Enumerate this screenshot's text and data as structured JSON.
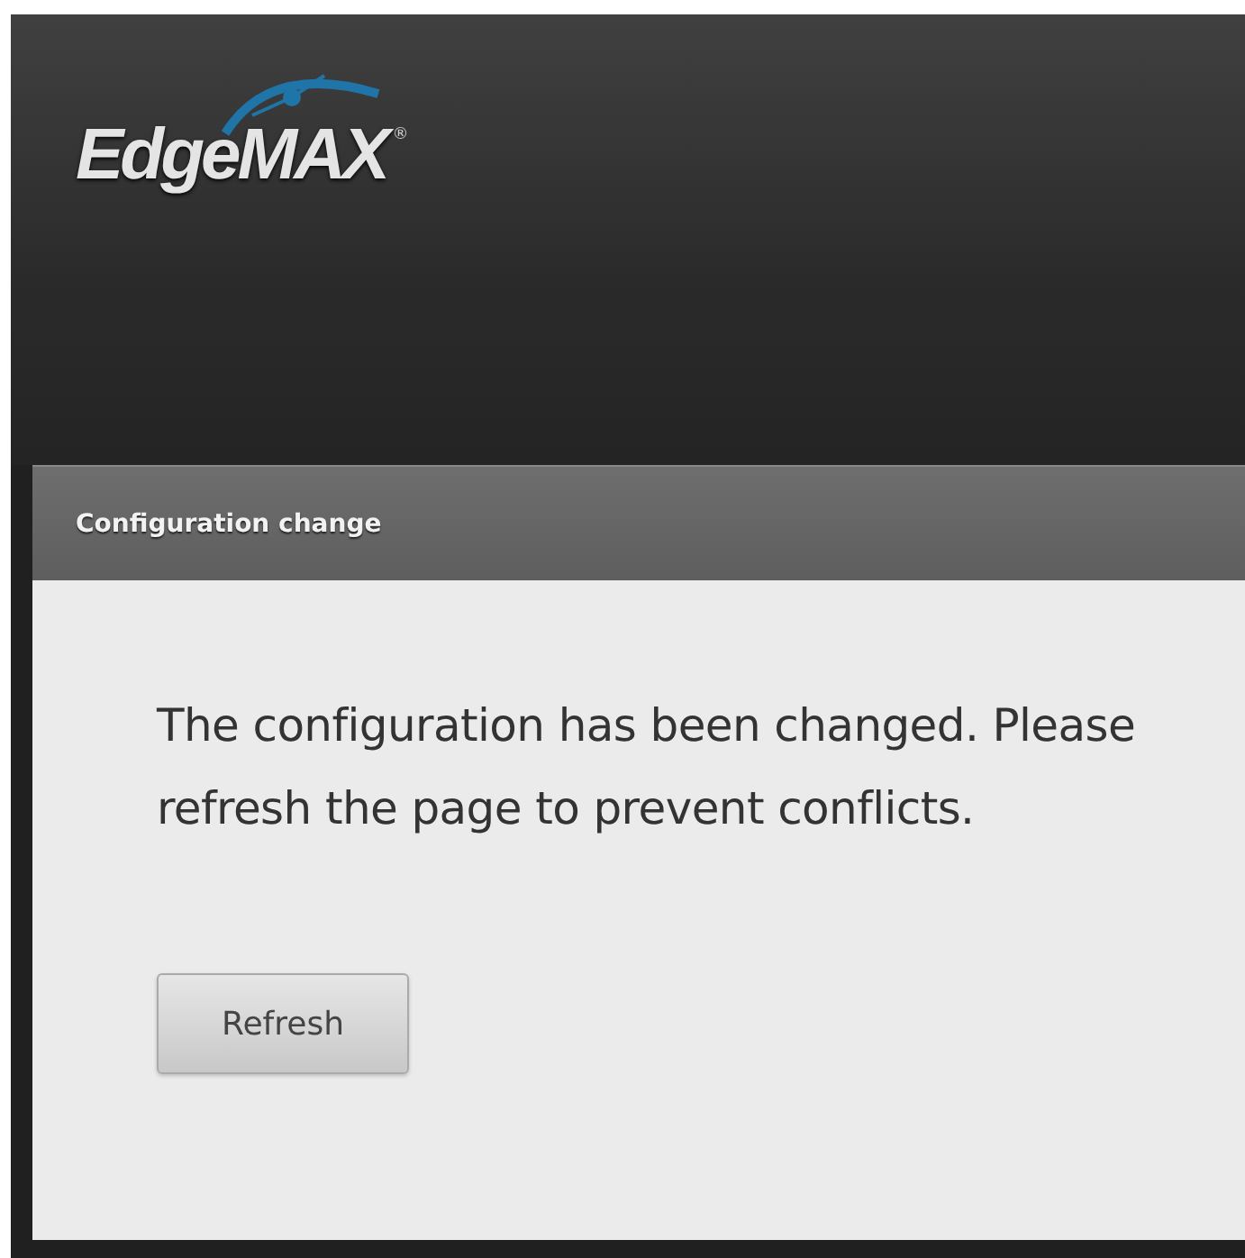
{
  "header": {
    "logo": {
      "text": "EdgeMAX",
      "mark": "®"
    }
  },
  "dialog": {
    "title": "Configuration change",
    "message": "The configuration has been changed. Please refresh the page to prevent conflicts.",
    "buttons": [
      "Refresh"
    ]
  }
}
